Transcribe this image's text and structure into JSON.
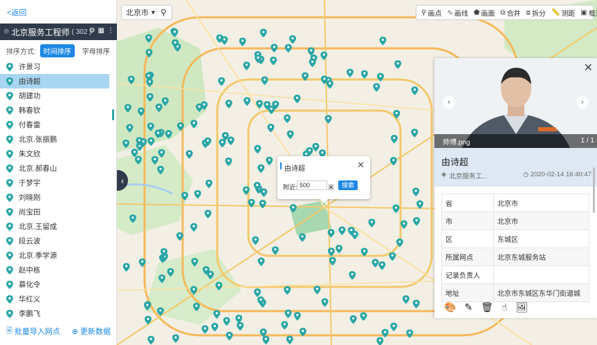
{
  "left": {
    "back_label": "<返回",
    "group_title": "北京服务工程师",
    "group_count": "( 302 )",
    "sort_label": "排序方式:",
    "sort_time": "时间排序",
    "sort_alpha": "字母排序",
    "items": [
      "许景习",
      "由诗超",
      "胡建功",
      "韩春钦",
      "付春雷",
      "北京.张振鹏",
      "朱文欣",
      "北京.郝春山",
      "于梦宇",
      "刘晓刚",
      "尚宝田",
      "北京.王留成",
      "段云波",
      "北京.季学源",
      "赵中栋",
      "慕化令",
      "华红义",
      "李鹏飞"
    ],
    "selected_index": 1,
    "import_label": "批量导入网点",
    "refresh_label": "更新数据"
  },
  "map": {
    "city": "北京市",
    "tools": [
      "画点",
      "画线",
      "画面",
      "合并",
      "拆分",
      "测距",
      "框选"
    ],
    "popup": {
      "title": "由诗超",
      "near_label": "附近:",
      "distance": "500",
      "unit": "米",
      "search_label": "搜索"
    }
  },
  "detail": {
    "photo_caption": "师傅.png",
    "photo_count": "1 / 1",
    "name": "由诗超",
    "group": "北京服务工...",
    "date": "2020-02-14 16:40:47",
    "rows": [
      {
        "key": "省",
        "value": "北京市"
      },
      {
        "key": "市",
        "value": "北京市"
      },
      {
        "key": "区",
        "value": "东城区"
      },
      {
        "key": "所属网点",
        "value": "北京东城服务站"
      },
      {
        "key": "记录负责人",
        "value": ""
      },
      {
        "key": "地址",
        "value": "北京市东城区东华门街道城"
      }
    ]
  },
  "colors": {
    "accent": "#1e88e5",
    "pin": "#2aa6a6",
    "header": "#2f3a4a",
    "selected": "#a8d5f0"
  }
}
